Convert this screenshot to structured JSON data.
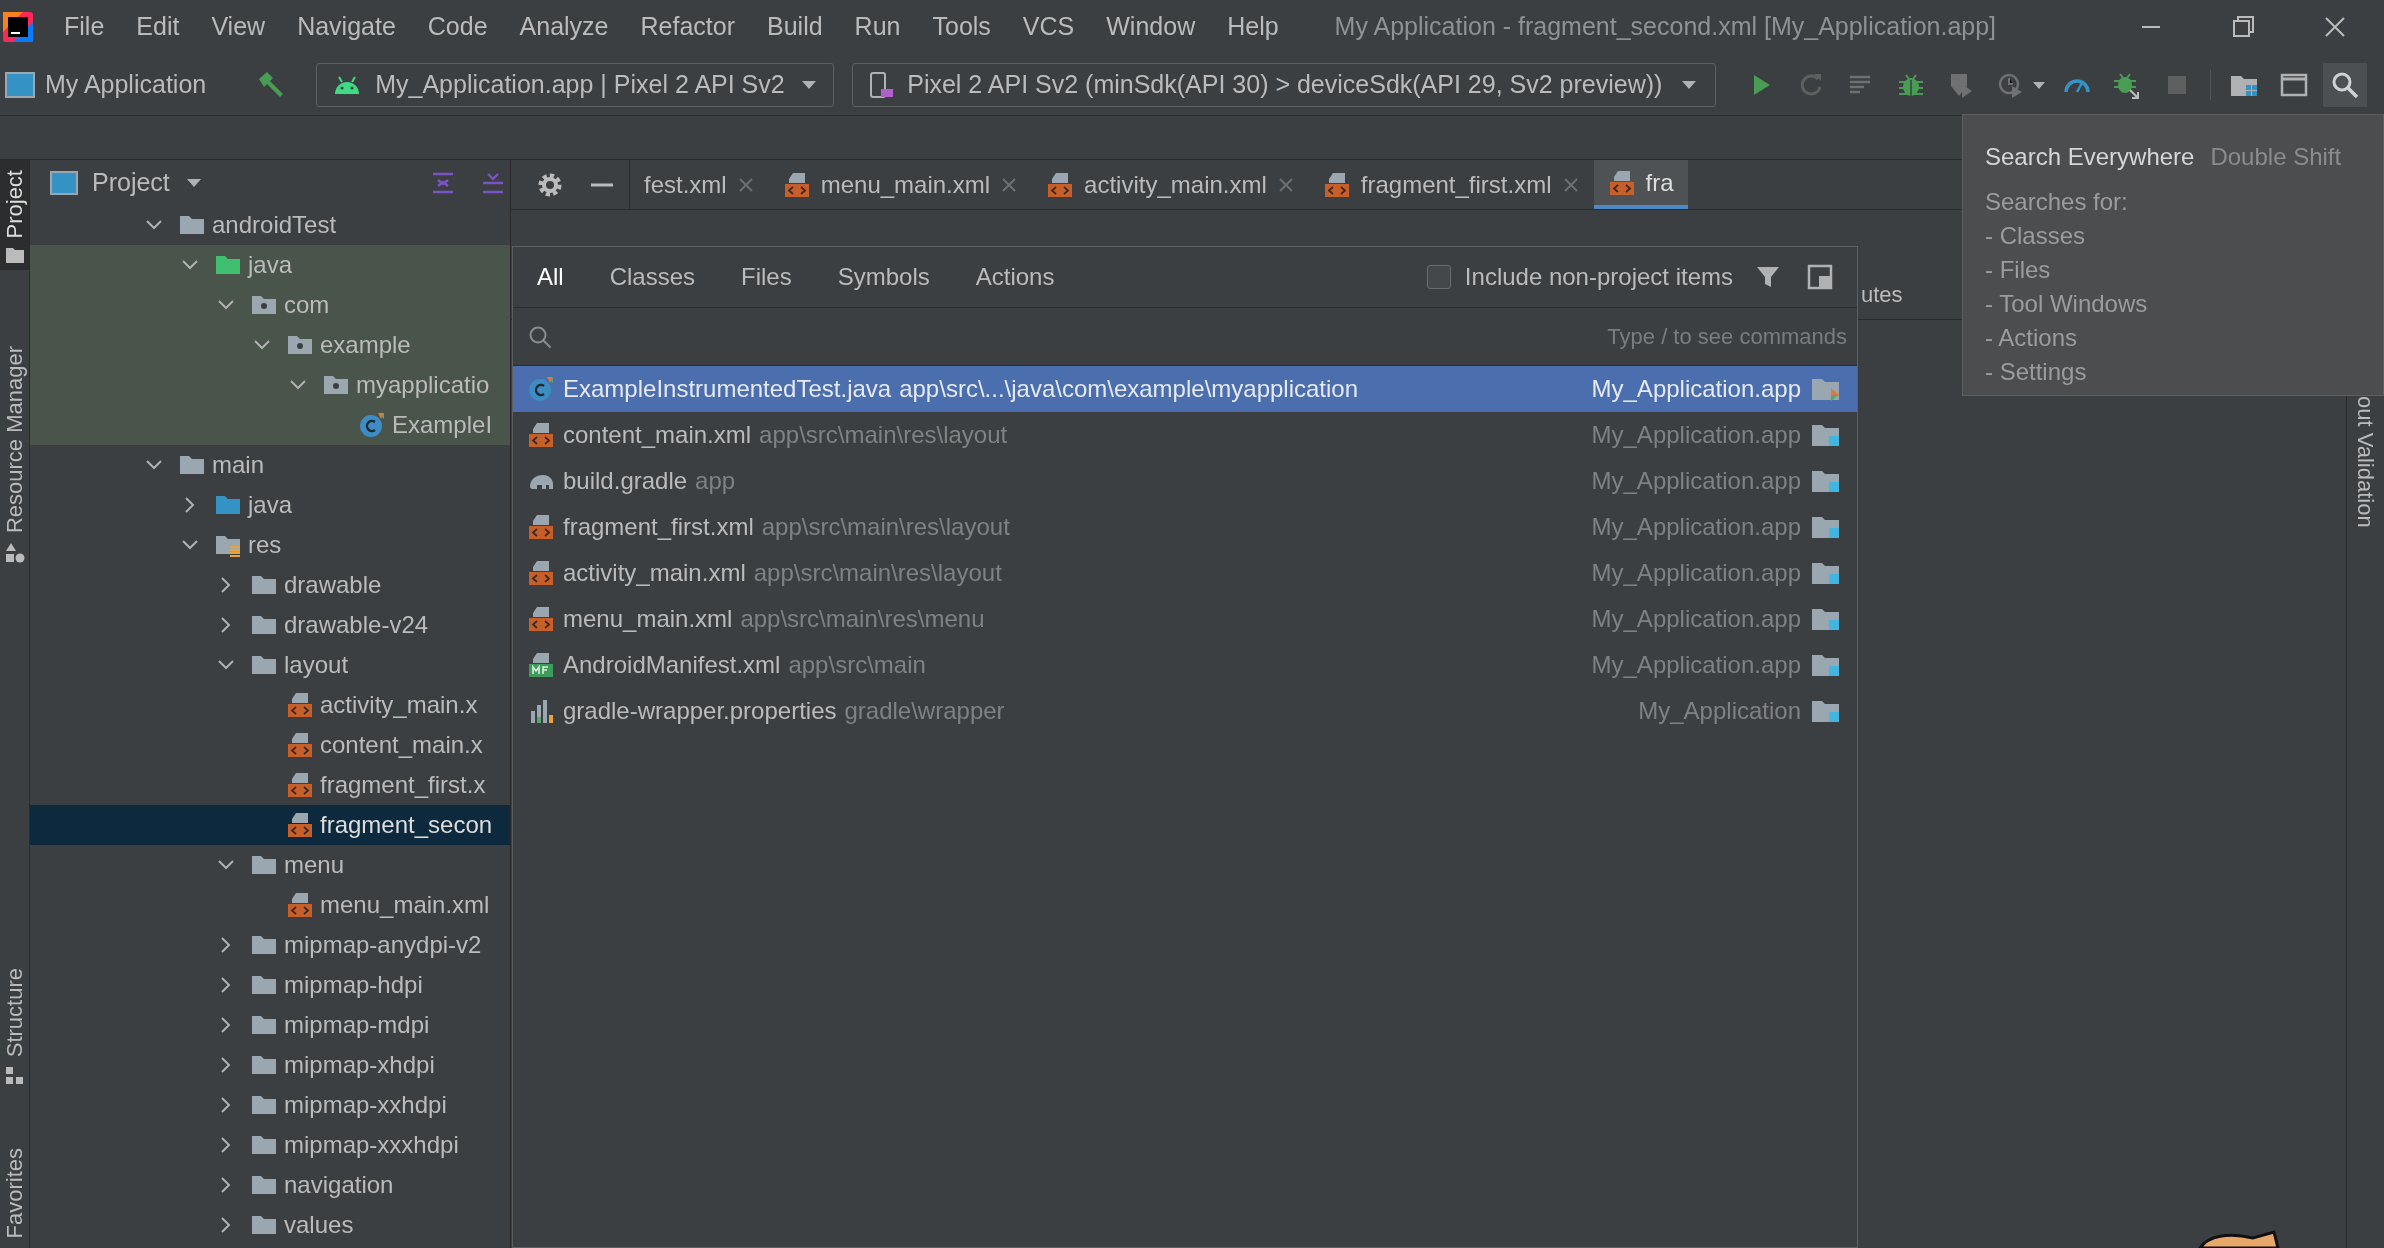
{
  "menu_bar": {
    "items": [
      "File",
      "Edit",
      "View",
      "Navigate",
      "Code",
      "Analyze",
      "Refactor",
      "Build",
      "Run",
      "Tools",
      "VCS",
      "Window",
      "Help"
    ],
    "title": "My Application - fragment_second.xml [My_Application.app]"
  },
  "toolbar": {
    "project": "My Application",
    "run_config": "My_Application.app | Pixel 2 API Sv2",
    "device": "Pixel 2 API Sv2 (minSdk(API 30) > deviceSdk(API 29, Sv2 preview))"
  },
  "left_strip": [
    {
      "label": "Project",
      "kind": "folder",
      "selected": true
    },
    {
      "label": "Resource Manager",
      "kind": "shapes",
      "selected": false
    },
    {
      "label": "Structure",
      "kind": "structure",
      "selected": false
    },
    {
      "label": "Favorites",
      "kind": "none",
      "selected": false
    }
  ],
  "project_panel": {
    "title": "Project",
    "tree": [
      {
        "label": "androidTest",
        "kind": "folder",
        "expanded": true,
        "selected": false,
        "children": [
          {
            "label": "java",
            "kind": "test_source",
            "expanded": true,
            "selected": false,
            "children": [
              {
                "label": "com",
                "kind": "package",
                "expanded": true,
                "selected": false,
                "children": [
                  {
                    "label": "example",
                    "kind": "package",
                    "expanded": true,
                    "selected": false,
                    "children": [
                      {
                        "label": "myapplicatio",
                        "kind": "package",
                        "expanded": true,
                        "selected": false,
                        "children": [
                          {
                            "label": "ExampleI",
                            "kind": "class",
                            "selected": false
                          }
                        ]
                      }
                    ]
                  }
                ]
              }
            ]
          }
        ]
      },
      {
        "label": "main",
        "kind": "folder",
        "expanded": true,
        "selected": false,
        "children": [
          {
            "label": "java",
            "kind": "source",
            "expanded": false,
            "selected": false
          },
          {
            "label": "res",
            "kind": "res",
            "expanded": true,
            "selected": false,
            "children": [
              {
                "label": "drawable",
                "kind": "folder",
                "expanded": false,
                "selected": false
              },
              {
                "label": "drawable-v24",
                "kind": "folder",
                "expanded": false,
                "selected": false
              },
              {
                "label": "layout",
                "kind": "folder",
                "expanded": true,
                "selected": false,
                "children": [
                  {
                    "label": "activity_main.x",
                    "kind": "xml",
                    "selected": false
                  },
                  {
                    "label": "content_main.x",
                    "kind": "xml",
                    "selected": false
                  },
                  {
                    "label": "fragment_first.x",
                    "kind": "xml",
                    "selected": false
                  },
                  {
                    "label": "fragment_secon",
                    "kind": "xml",
                    "selected": true
                  }
                ]
              },
              {
                "label": "menu",
                "kind": "folder",
                "expanded": true,
                "selected": false,
                "children": [
                  {
                    "label": "menu_main.xml",
                    "kind": "xml",
                    "selected": false
                  }
                ]
              },
              {
                "label": "mipmap-anydpi-v2",
                "kind": "folder",
                "expanded": false,
                "selected": false
              },
              {
                "label": "mipmap-hdpi",
                "kind": "folder",
                "expanded": false,
                "selected": false
              },
              {
                "label": "mipmap-mdpi",
                "kind": "folder",
                "expanded": false,
                "selected": false
              },
              {
                "label": "mipmap-xhdpi",
                "kind": "folder",
                "expanded": false,
                "selected": false
              },
              {
                "label": "mipmap-xxhdpi",
                "kind": "folder",
                "expanded": false,
                "selected": false
              },
              {
                "label": "mipmap-xxxhdpi",
                "kind": "folder",
                "expanded": false,
                "selected": false
              },
              {
                "label": "navigation",
                "kind": "folder",
                "expanded": false,
                "selected": false
              },
              {
                "label": "values",
                "kind": "folder",
                "expanded": false,
                "selected": false
              }
            ]
          }
        ]
      }
    ]
  },
  "editor_tabs": [
    {
      "label": "fest.xml",
      "kind": "partial",
      "selected": false
    },
    {
      "label": "menu_main.xml",
      "kind": "xml",
      "selected": false
    },
    {
      "label": "activity_main.xml",
      "kind": "xml",
      "selected": false
    },
    {
      "label": "fragment_first.xml",
      "kind": "xml",
      "selected": false
    },
    {
      "label": "fra",
      "kind": "xml",
      "selected": true
    }
  ],
  "attributes_tab": "utes",
  "right_strip": {
    "label": "out Validation"
  },
  "search_popup": {
    "tabs": [
      {
        "label": "All",
        "selected": true
      },
      {
        "label": "Classes",
        "selected": false
      },
      {
        "label": "Files",
        "selected": false
      },
      {
        "label": "Symbols",
        "selected": false
      },
      {
        "label": "Actions",
        "selected": false
      }
    ],
    "include_non_project": {
      "label": "Include non-project items",
      "checked": false
    },
    "placeholder": "Type / to see commands",
    "results": [
      {
        "kind": "class",
        "name": "ExampleInstrumentedTest.java",
        "path": "app\\src\\...\\java\\com\\example\\myapplication",
        "module": "My_Application.app",
        "test_module": true,
        "selected": true
      },
      {
        "kind": "xml",
        "name": "content_main.xml",
        "path": "app\\src\\main\\res\\layout",
        "module": "My_Application.app",
        "test_module": false,
        "selected": false
      },
      {
        "kind": "gradle",
        "name": "build.gradle",
        "path": "app",
        "module": "My_Application.app",
        "test_module": false,
        "selected": false
      },
      {
        "kind": "xml",
        "name": "fragment_first.xml",
        "path": "app\\src\\main\\res\\layout",
        "module": "My_Application.app",
        "test_module": false,
        "selected": false
      },
      {
        "kind": "xml",
        "name": "activity_main.xml",
        "path": "app\\src\\main\\res\\layout",
        "module": "My_Application.app",
        "test_module": false,
        "selected": false
      },
      {
        "kind": "xml",
        "name": "menu_main.xml",
        "path": "app\\src\\main\\res\\menu",
        "module": "My_Application.app",
        "test_module": false,
        "selected": false
      },
      {
        "kind": "manifest",
        "name": "AndroidManifest.xml",
        "path": "app\\src\\main",
        "module": "My_Application.app",
        "test_module": false,
        "selected": false
      },
      {
        "kind": "properties",
        "name": "gradle-wrapper.properties",
        "path": "gradle\\wrapper",
        "module": "My_Application",
        "test_module": false,
        "selected": false
      }
    ]
  },
  "tooltip": {
    "title": "Search Everywhere",
    "shortcut": "Double Shift",
    "subtitle": "Searches for:",
    "items": [
      "- Classes",
      "- Files",
      "- Tool Windows",
      "- Actions",
      "- Settings"
    ]
  }
}
